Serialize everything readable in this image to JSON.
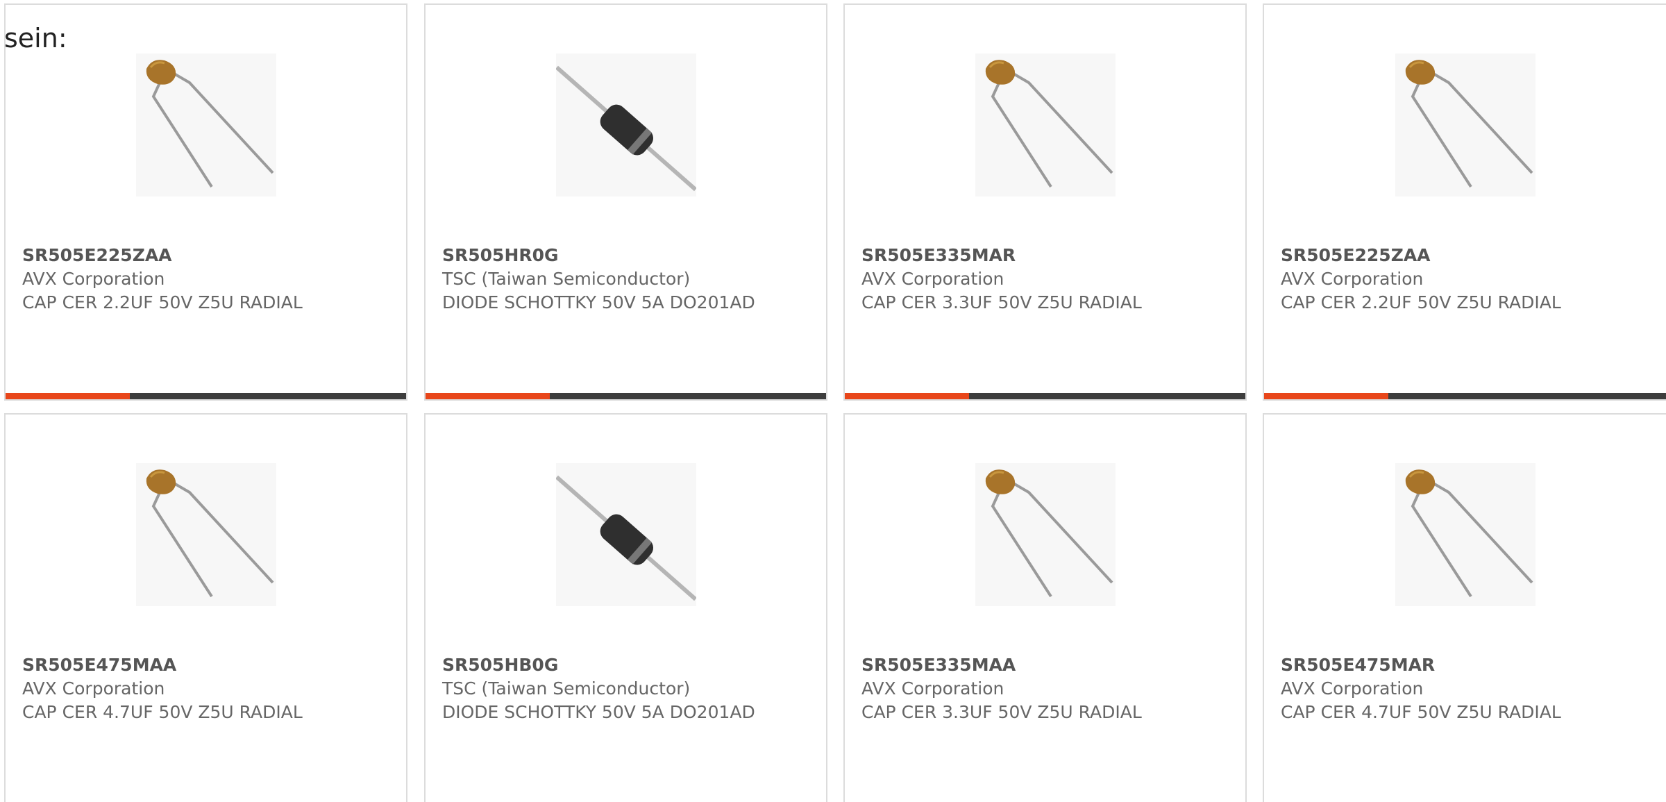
{
  "lead_text": "sein:",
  "colors": {
    "accent": "#e8461a",
    "bar": "#3d3d3d",
    "border": "#dcdcdc"
  },
  "cards": [
    {
      "part": "SR505E225ZAA",
      "manufacturer": "AVX Corporation",
      "description": "CAP CER 2.2UF 50V Z5U RADIAL",
      "icon": "ceramic-capacitor-icon",
      "progress": 0.31
    },
    {
      "part": "SR505HR0G",
      "manufacturer": "TSC (Taiwan Semiconductor)",
      "description": "DIODE SCHOTTKY 50V 5A DO201AD",
      "icon": "schottky-diode-icon",
      "progress": 0.31
    },
    {
      "part": "SR505E335MAR",
      "manufacturer": "AVX Corporation",
      "description": "CAP CER 3.3UF 50V Z5U RADIAL",
      "icon": "ceramic-capacitor-icon",
      "progress": 0.31
    },
    {
      "part": "SR505E225ZAA",
      "manufacturer": "AVX Corporation",
      "description": "CAP CER 2.2UF 50V Z5U RADIAL",
      "icon": "ceramic-capacitor-icon",
      "progress": 0.31
    },
    {
      "part": "SR505E475MAA",
      "manufacturer": "AVX Corporation",
      "description": "CAP CER 4.7UF 50V Z5U RADIAL",
      "icon": "ceramic-capacitor-icon",
      "progress": null
    },
    {
      "part": "SR505HB0G",
      "manufacturer": "TSC (Taiwan Semiconductor)",
      "description": "DIODE SCHOTTKY 50V 5A DO201AD",
      "icon": "schottky-diode-icon",
      "progress": null
    },
    {
      "part": "SR505E335MAA",
      "manufacturer": "AVX Corporation",
      "description": "CAP CER 3.3UF 50V Z5U RADIAL",
      "icon": "ceramic-capacitor-icon",
      "progress": null
    },
    {
      "part": "SR505E475MAR",
      "manufacturer": "AVX Corporation",
      "description": "CAP CER 4.7UF 50V Z5U RADIAL",
      "icon": "ceramic-capacitor-icon",
      "progress": null
    }
  ]
}
